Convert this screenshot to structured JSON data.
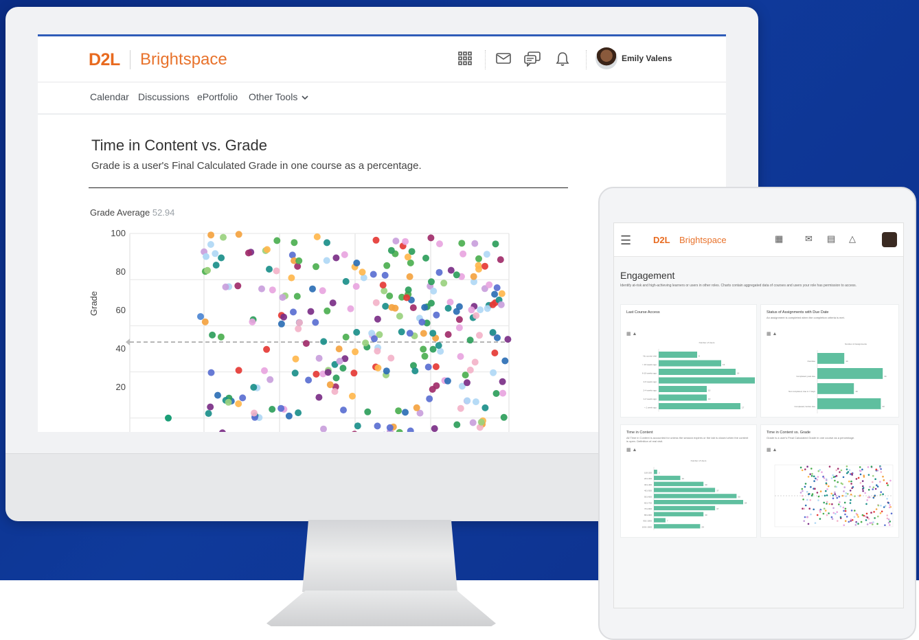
{
  "desktop": {
    "brand": {
      "mark": "D2L",
      "name": "Brightspace"
    },
    "user": {
      "name": "Emily Valens"
    },
    "header_icons": [
      "apps-grid-icon",
      "mail-icon",
      "chat-icon",
      "bell-icon"
    ],
    "nav": [
      {
        "label": "Calendar"
      },
      {
        "label": "Discussions"
      },
      {
        "label": "ePortfolio"
      },
      {
        "label": "Other Tools"
      }
    ],
    "panel": {
      "title": "Time in Content vs. Grade",
      "subtitle": "Grade is a user's Final Calculated Grade in one course as a percentage.",
      "grade_average_label": "Grade Average",
      "grade_average_value": "52.94",
      "ylabel": "Grade",
      "yticks": [
        "100",
        "80",
        "60",
        "40",
        "20"
      ]
    }
  },
  "tablet": {
    "brand": {
      "mark": "D2L",
      "name": "Brightspace"
    },
    "title": "Engagement",
    "description": "Identify at-risk and high-achieving learners or users in other roles. Charts contain aggregated data of courses and users your role has permission to access.",
    "cards": [
      {
        "title": "Last Course Access",
        "subtitle": ""
      },
      {
        "title": "Status of Assignments with Due Date",
        "subtitle": "An assignment is completed when the completion criteria is met."
      },
      {
        "title": "Time in Content",
        "subtitle": "All Time in Content is accounted for unless the session expires or the tab is closed when the content is open. Definition of real visit."
      },
      {
        "title": "Time in Content vs. Grade",
        "subtitle": "Grade is a user's Final Calculated Grade in one course as a percentage."
      }
    ]
  },
  "colors": {
    "brand_orange": "#e86a1f",
    "background_blue": "#0f3a9b",
    "bar_teal": "#5fbf9f"
  },
  "chart_data": [
    {
      "type": "scatter",
      "title": "Time in Content vs. Grade",
      "ylabel": "Grade",
      "ylim": [
        0,
        100
      ],
      "yticks": [
        100,
        80,
        60,
        40,
        20
      ],
      "reference_line": {
        "label": "Grade Average",
        "value": 52.94
      },
      "grid": true,
      "point_count": 320,
      "palette": [
        "#2e9e5b",
        "#7b2f87",
        "#e53935",
        "#f4a340",
        "#c9a0dc",
        "#f3b3c9",
        "#5a6fd1",
        "#9ad17f",
        "#2c6fb5",
        "#1b8f8a",
        "#b0d8f5",
        "#e8a5e0",
        "#a12d6a",
        "#4caf50",
        "#ffb74d"
      ]
    },
    {
      "type": "bar",
      "title": "Last Course Access",
      "xlabel": "Number of Users",
      "categories": [
        "No course visit",
        "> 10 weeks ago",
        "6-10 weeks ago",
        "4-6 weeks ago",
        "2-4 weeks ago",
        "1-2 weeks ago",
        "< 1 week ago"
      ],
      "values": [
        8,
        13,
        16,
        20,
        10,
        10,
        17
      ]
    },
    {
      "type": "bar",
      "title": "Status of Assignments with Due Date",
      "xlabel": "Number of Assignments",
      "categories": [
        "Overdue",
        "Completed, past due",
        "Not completed, due in 7 days",
        "Completed, before due"
      ],
      "values": [
        14,
        34,
        19,
        33
      ]
    },
    {
      "type": "bar",
      "title": "Time in Content",
      "xlabel": "Number of Users",
      "categories": [
        "100-200",
        "201-300",
        "301-400",
        "401-500",
        "501-600",
        "601-700",
        "701-800",
        "801-900",
        "901-1000",
        "1001-1500"
      ],
      "values": [
        2,
        16,
        30,
        37,
        50,
        54,
        37,
        30,
        7,
        28
      ]
    }
  ]
}
